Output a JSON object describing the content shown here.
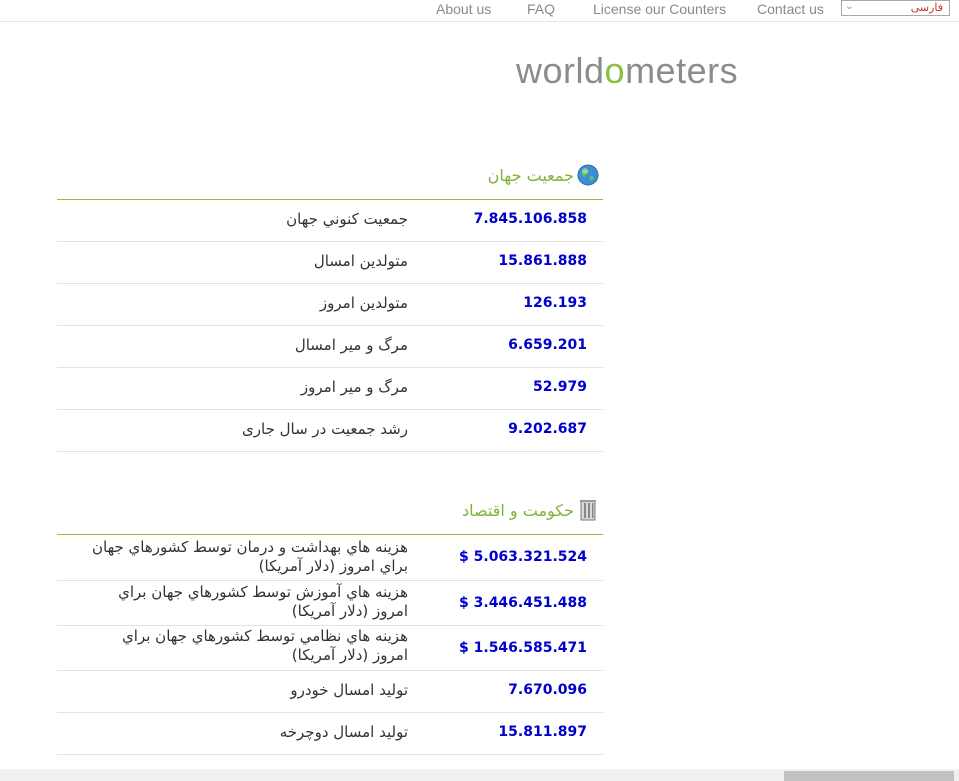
{
  "nav": {
    "links": [
      "About us",
      "FAQ",
      "License our Counters",
      "Contact us"
    ],
    "language": "فارسی"
  },
  "logo": {
    "prefix": "world",
    "accent": "o",
    "suffix": "meters"
  },
  "population": {
    "title": "جمعیت جهان",
    "rows": [
      {
        "label": "جمعيت كنوني جهان",
        "value": "7.845.106.858"
      },
      {
        "label": "متولدين امسال",
        "value": "15.861.888"
      },
      {
        "label": "متولدين امروز",
        "value": "126.193"
      },
      {
        "label": "مرگ و مير امسال",
        "value": "6.659.201"
      },
      {
        "label": "مرگ و مير امروز",
        "value": "52.979"
      },
      {
        "label": "رشد جمعيت در سال جاری",
        "value": "9.202.687"
      }
    ]
  },
  "government": {
    "title": "حکومت و اقتصاد",
    "rows": [
      {
        "label": "هزينه هاي بهداشت و درمان توسط كشورهاي جهان براي امروز (دلار آمريكا)",
        "value": "$ 5.063.321.524"
      },
      {
        "label": "هزينه هاي آموزش توسط كشورهاي جهان براي امروز (دلار آمريكا)",
        "value": "$ 3.446.451.488"
      },
      {
        "label": "هزينه هاي نظامي توسط كشورهاي جهان براي امروز (دلار آمريكا)",
        "value": "$ 1.546.585.471"
      },
      {
        "label": "توليد امسال خودرو",
        "value": "7.670.096"
      },
      {
        "label": "توليد امسال دوچرخه",
        "value": "15.811.897"
      }
    ]
  },
  "colors": {
    "accent_green": "#8cbe3f",
    "value_blue": "#0000cc",
    "nav_gray": "#8a8a8a"
  }
}
